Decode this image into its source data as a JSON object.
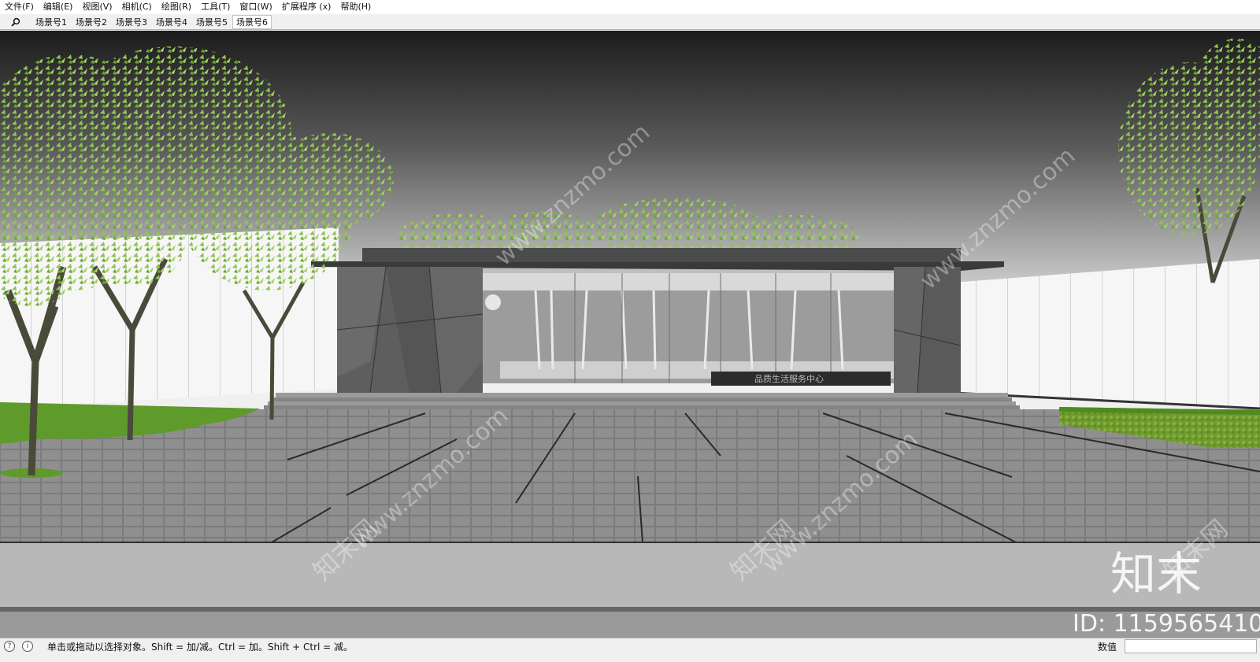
{
  "menu": [
    {
      "label": "文件(F)"
    },
    {
      "label": "编辑(E)"
    },
    {
      "label": "视图(V)"
    },
    {
      "label": "相机(C)"
    },
    {
      "label": "绘图(R)"
    },
    {
      "label": "工具(T)"
    },
    {
      "label": "窗口(W)"
    },
    {
      "label": "扩展程序 (x)"
    },
    {
      "label": "帮助(H)"
    }
  ],
  "scenes": {
    "tabs": [
      {
        "label": "场景号1"
      },
      {
        "label": "场景号2"
      },
      {
        "label": "场景号3"
      },
      {
        "label": "场景号4"
      },
      {
        "label": "场景号5"
      },
      {
        "label": "场景号6"
      }
    ],
    "active_tab": "场景号6"
  },
  "viewport": {
    "building_sign": "品质生活服务中心",
    "watermark_site": "www.znzmo.com",
    "watermark_cn": "知末网",
    "logo_text": "知末",
    "id_label": "ID: 1159565410"
  },
  "statusbar": {
    "hint": "单击或拖动以选择对象。Shift = 加/减。Ctrl = 加。Shift + Ctrl = 减。",
    "value_label": "数值",
    "value": ""
  },
  "colors": {
    "sky_top": "#1c1c1c",
    "sky_bottom": "#c9c9c9",
    "pavement": "#8c8c8c",
    "foliage": "#8fc354",
    "wall": "#f4f4f4"
  }
}
